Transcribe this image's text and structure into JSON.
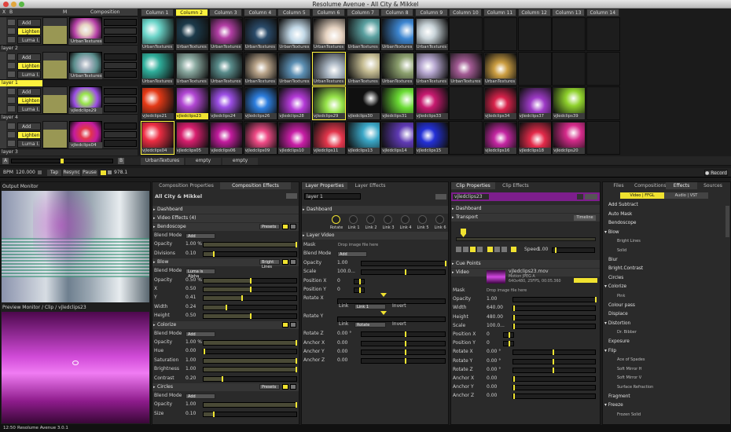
{
  "window": {
    "title": "Resolume Avenue - All City & Mikkel"
  },
  "composition_header": {
    "x": "X",
    "b": "B",
    "m": "M",
    "label": "Composition"
  },
  "columns": [
    "Column 1",
    "Column 2",
    "Column 3",
    "Column 4",
    "Column 5",
    "Column 6",
    "Column 7",
    "Column 8",
    "Column 9",
    "Column 10",
    "Column 11",
    "Column 12",
    "Column 13",
    "Column 14"
  ],
  "layers": [
    {
      "name": "layer 2",
      "add": "Add",
      "blend": "Lighten",
      "luma": "Luma I.",
      "clip": "UrbanTextures 13",
      "clips": [
        "UrbanTextures 10",
        "UrbanTextures 3",
        "UrbanTextures 9",
        "UrbanTextures 6",
        "UrbanTextures 11",
        "UrbanTextures 19",
        "UrbanTextures 20",
        "UrbanTextures 17",
        "UrbanTextures 4",
        "",
        "",
        "",
        "",
        ""
      ]
    },
    {
      "name": "layer 1",
      "add": "Add",
      "blend": "Lighten",
      "luma": "Luma I.",
      "clip": "UrbanTextures 18",
      "clips": [
        "UrbanTextures 8",
        "UrbanTextures 2",
        "UrbanTextures 10",
        "UrbanTextures 14",
        "UrbanTextures 16",
        "UrbanTextures 18",
        "UrbanTextures 5",
        "UrbanTextures 15",
        "UrbanTextures 1",
        "UrbanTextures 12",
        "UrbanTextures 7",
        "",
        "",
        ""
      ]
    },
    {
      "name": "layer 4",
      "add": "Add",
      "blend": "Lighten",
      "luma": "Luma I.",
      "clip": "vjledclips29",
      "clips": [
        "vjledclips21",
        "vjledclips23",
        "vjledclips24",
        "vjledclips26",
        "vjledclips28",
        "vjledclips29",
        "vjledclips30",
        "vjledclips31",
        "vjledclips33",
        "",
        "vjledclips34",
        "vjledclips37",
        "vjledclips39",
        ""
      ]
    },
    {
      "name": "layer 3",
      "add": "Add",
      "blend": "Lighten",
      "luma": "Luma I.",
      "clip": "vjledclips04",
      "clips": [
        "vjledclips04",
        "vjledclips05",
        "vjledclips06",
        "vjledclips09",
        "vjledclips10",
        "vjledclips11",
        "vjledclips13",
        "vjledclips14",
        "vjledclips15",
        "",
        "vjledclips16",
        "vjledclips18",
        "vjledclips20",
        ""
      ]
    }
  ],
  "bottom_row": {
    "a": "A",
    "b": "B",
    "decks": [
      "UrbanTextures",
      "empty",
      "empty"
    ]
  },
  "transport": {
    "bpm_label": "BPM",
    "bpm": "120.000",
    "tap": "Tap",
    "resync": "Resync",
    "pause": "Pause",
    "fps": "978.1",
    "record": "Record"
  },
  "output_monitor": {
    "title": "Output Monitor",
    "preview_title": "Preview Monitor / Clip / vjledclips23"
  },
  "composition": {
    "tabs": [
      "Composition Properties",
      "Composition Effects"
    ],
    "name": "All City & Mikkel",
    "dashboard": "Dashboard",
    "video_effects": "Video Effects (4)",
    "effects": [
      {
        "name": "Bendoscope",
        "params": [
          [
            "Blend Mode",
            "Add"
          ],
          [
            "Opacity",
            "1.00 %"
          ],
          [
            "Divisions",
            "0.10"
          ]
        ]
      },
      {
        "name": "Blow",
        "params": [
          [
            "Blend Mode",
            "Luma is Alpha"
          ],
          [
            "Opacity",
            "0.50 %"
          ],
          [
            "X",
            "0.50"
          ],
          [
            "Y",
            "0.41"
          ],
          [
            "Width",
            "0.24"
          ],
          [
            "Height",
            "0.50"
          ]
        ],
        "extra": "Bright Lines"
      },
      {
        "name": "Colorize",
        "params": [
          [
            "Blend Mode",
            "Add"
          ],
          [
            "Opacity",
            "1.00 %"
          ],
          [
            "Hue",
            "0.00"
          ],
          [
            "Saturation",
            "1.00"
          ],
          [
            "Brightness",
            "1.00"
          ],
          [
            "Contrast",
            "0.20"
          ]
        ]
      },
      {
        "name": "Circles",
        "params": [
          [
            "Blend Mode",
            "Add"
          ],
          [
            "Opacity",
            "1.00"
          ],
          [
            "Size",
            "0.10"
          ]
        ]
      }
    ],
    "presets": "Presets"
  },
  "layer_props": {
    "tabs": [
      "Layer Properties",
      "Layer Effects"
    ],
    "name": "layer 1",
    "dashboard": "Dashboard",
    "knobs": [
      "Rotate",
      "Link 1",
      "Link 2",
      "Link 3",
      "Link 4",
      "Link 5",
      "Link 6"
    ],
    "layer_video": "Layer Video",
    "params": [
      [
        "Mask",
        "Drop image file here"
      ],
      [
        "Blend Mode",
        "Add"
      ],
      [
        "Opacity",
        "1.00"
      ],
      [
        "Scale",
        "100.0..."
      ],
      [
        "Position X",
        "0"
      ],
      [
        "Position Y",
        "0"
      ],
      [
        "Rotate X",
        ""
      ],
      [
        "Rotate Y",
        ""
      ],
      [
        "Rotate Z",
        "0.00 °"
      ],
      [
        "Anchor X",
        "0.00"
      ],
      [
        "Anchor Y",
        "0.00"
      ],
      [
        "Anchor Z",
        "0.00"
      ]
    ],
    "link": "Link",
    "link_val": "Link 1",
    "rotate": "Rotate",
    "invert": "Invert"
  },
  "clip_props": {
    "tabs": [
      "Clip Properties",
      "Clip Effects"
    ],
    "name": "vjledclips23",
    "dashboard": "Dashboard",
    "transport": "Transport",
    "timeline": "Timeline",
    "speed": "Speed",
    "speed_val": "1.00",
    "cue": "Cue Points",
    "video": "Video",
    "file": "vjledclips23.mov",
    "codec": "Motion JPEG A",
    "info": "640x480, 25FPS, 00:05.360",
    "params": [
      [
        "Mask",
        "Drop image file here"
      ],
      [
        "Opacity",
        "1.00"
      ],
      [
        "Width",
        "640.00"
      ],
      [
        "Height",
        "480.00"
      ],
      [
        "Scale",
        "100.0..."
      ],
      [
        "Position X",
        "0"
      ],
      [
        "Position Y",
        "0"
      ],
      [
        "Rotate X",
        "0.00 °"
      ],
      [
        "Rotate Y",
        "0.00 °"
      ],
      [
        "Rotate Z",
        "0.00 °"
      ],
      [
        "Anchor X",
        "0.00"
      ],
      [
        "Anchor Y",
        "0.00"
      ],
      [
        "Anchor Z",
        "0.00"
      ]
    ]
  },
  "browser": {
    "tabs": [
      "Files",
      "Compositions",
      "Effects",
      "Sources"
    ],
    "subtabs": [
      "Video | FFGL",
      "Audio | VST"
    ],
    "items": [
      [
        "Add Subtract",
        0
      ],
      [
        "Auto Mask",
        0
      ],
      [
        "Bendoscope",
        0
      ],
      [
        "Blow",
        2
      ],
      [
        "Bright Lines",
        1
      ],
      [
        "Solid",
        1
      ],
      [
        "Blur",
        0
      ],
      [
        "Bright.Contrast",
        0
      ],
      [
        "Circles",
        0
      ],
      [
        "Colorize",
        2
      ],
      [
        "Pink",
        1
      ],
      [
        "Colour pass",
        0
      ],
      [
        "Displace",
        0
      ],
      [
        "Distortion",
        2
      ],
      [
        "Dr. Bibber",
        1
      ],
      [
        "Exposure",
        0
      ],
      [
        "Flip",
        2
      ],
      [
        "Ace of Spades",
        1
      ],
      [
        "Soft Mirror H",
        1
      ],
      [
        "Soft Mirror V",
        1
      ],
      [
        "Surface Refraction",
        1
      ],
      [
        "Fragment",
        0
      ],
      [
        "Freeze",
        2
      ],
      [
        "Frozen Solid",
        1
      ]
    ]
  },
  "status": {
    "time": "12:50",
    "version": "Resolume Avenue 3.0.1"
  }
}
